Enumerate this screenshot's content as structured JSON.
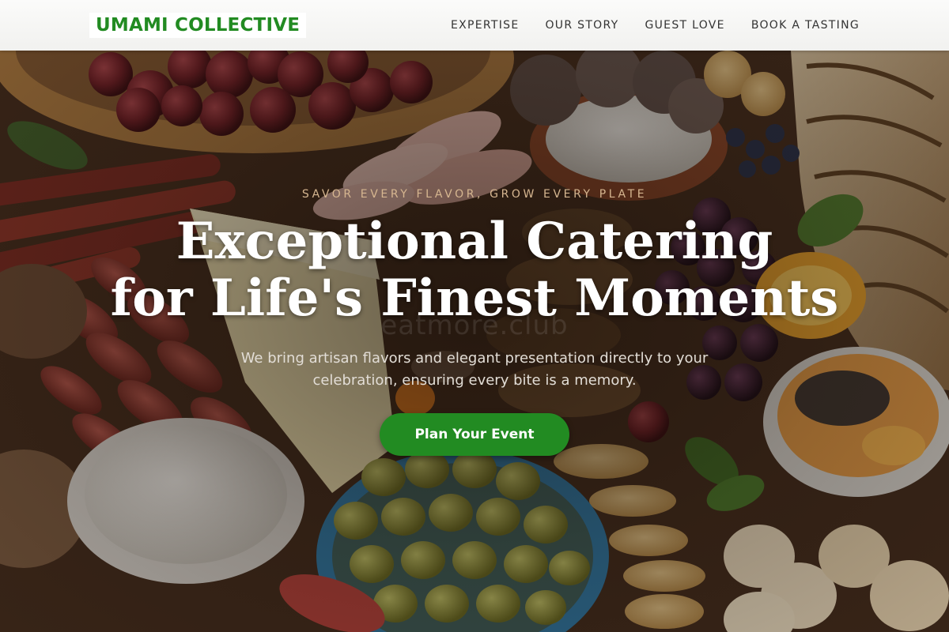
{
  "header": {
    "logo": "UMAMI COLLECTIVE",
    "nav": [
      {
        "label": "EXPERTISE"
      },
      {
        "label": "OUR STORY"
      },
      {
        "label": "GUEST LOVE"
      },
      {
        "label": "BOOK A TASTING"
      }
    ]
  },
  "hero": {
    "tagline": "SAVOR EVERY FLAVOR, GROW EVERY PLATE",
    "headline_line1": "Exceptional Catering",
    "headline_line2": "for Life's Finest Moments",
    "subtitle": "We bring artisan flavors and elegant presentation directly to your celebration, ensuring every bite is a memory.",
    "cta_label": "Plan Your Event",
    "watermark": "eatmore.club"
  },
  "colors": {
    "brand_green": "#228b22",
    "tagline_tan": "#d6b690",
    "header_bg": "#f4f4f2"
  },
  "icons": []
}
